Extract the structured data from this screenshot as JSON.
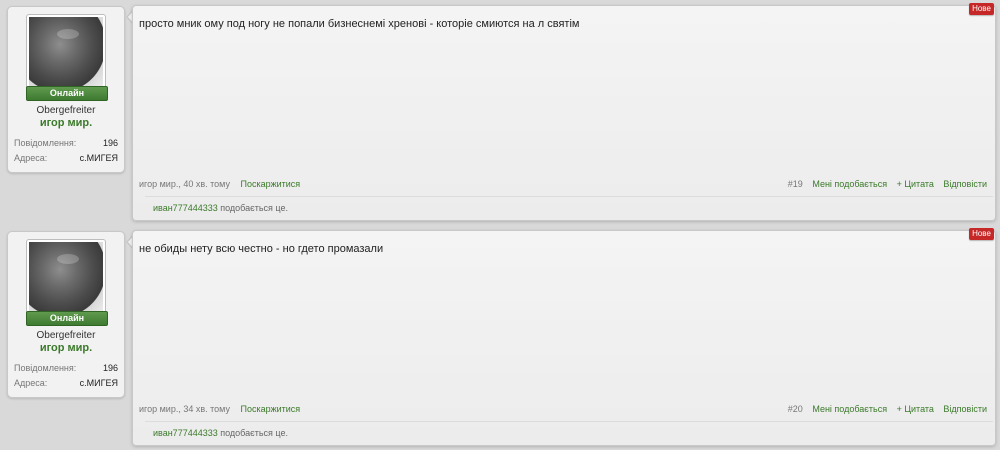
{
  "posts": [
    {
      "user": {
        "online_label": "Онлайн",
        "rank": "Obergefreiter",
        "name": "игор мир.",
        "stats": [
          {
            "label": "Повідомлення:",
            "value": "196"
          },
          {
            "label": "Адреса:",
            "value": "с.МИГЕЯ"
          }
        ]
      },
      "new_badge": "Нове",
      "message": "просто мник ому под ногу не попали бизнеснемі хренові - которіе смиются на л святім",
      "author_time": "игор мир., 40 хв. тому",
      "report": "Поскаржитися",
      "number": "#19",
      "like": "Мені подобається",
      "quote": "+ Цитата",
      "reply": "Відповісти",
      "liked_by": "иван777444333",
      "likes_suffix": " подобається це."
    },
    {
      "user": {
        "online_label": "Онлайн",
        "rank": "Obergefreiter",
        "name": "игор мир.",
        "stats": [
          {
            "label": "Повідомлення:",
            "value": "196"
          },
          {
            "label": "Адреса:",
            "value": "с.МИГЕЯ"
          }
        ]
      },
      "new_badge": "Нове",
      "message": "не обиды нету всю честно - но гдето промазали",
      "author_time": "игор мир., 34 хв. тому",
      "report": "Поскаржитися",
      "number": "#20",
      "like": "Мені подобається",
      "quote": "+ Цитата",
      "reply": "Відповісти",
      "liked_by": "иван777444333",
      "likes_suffix": " подобається це."
    }
  ]
}
